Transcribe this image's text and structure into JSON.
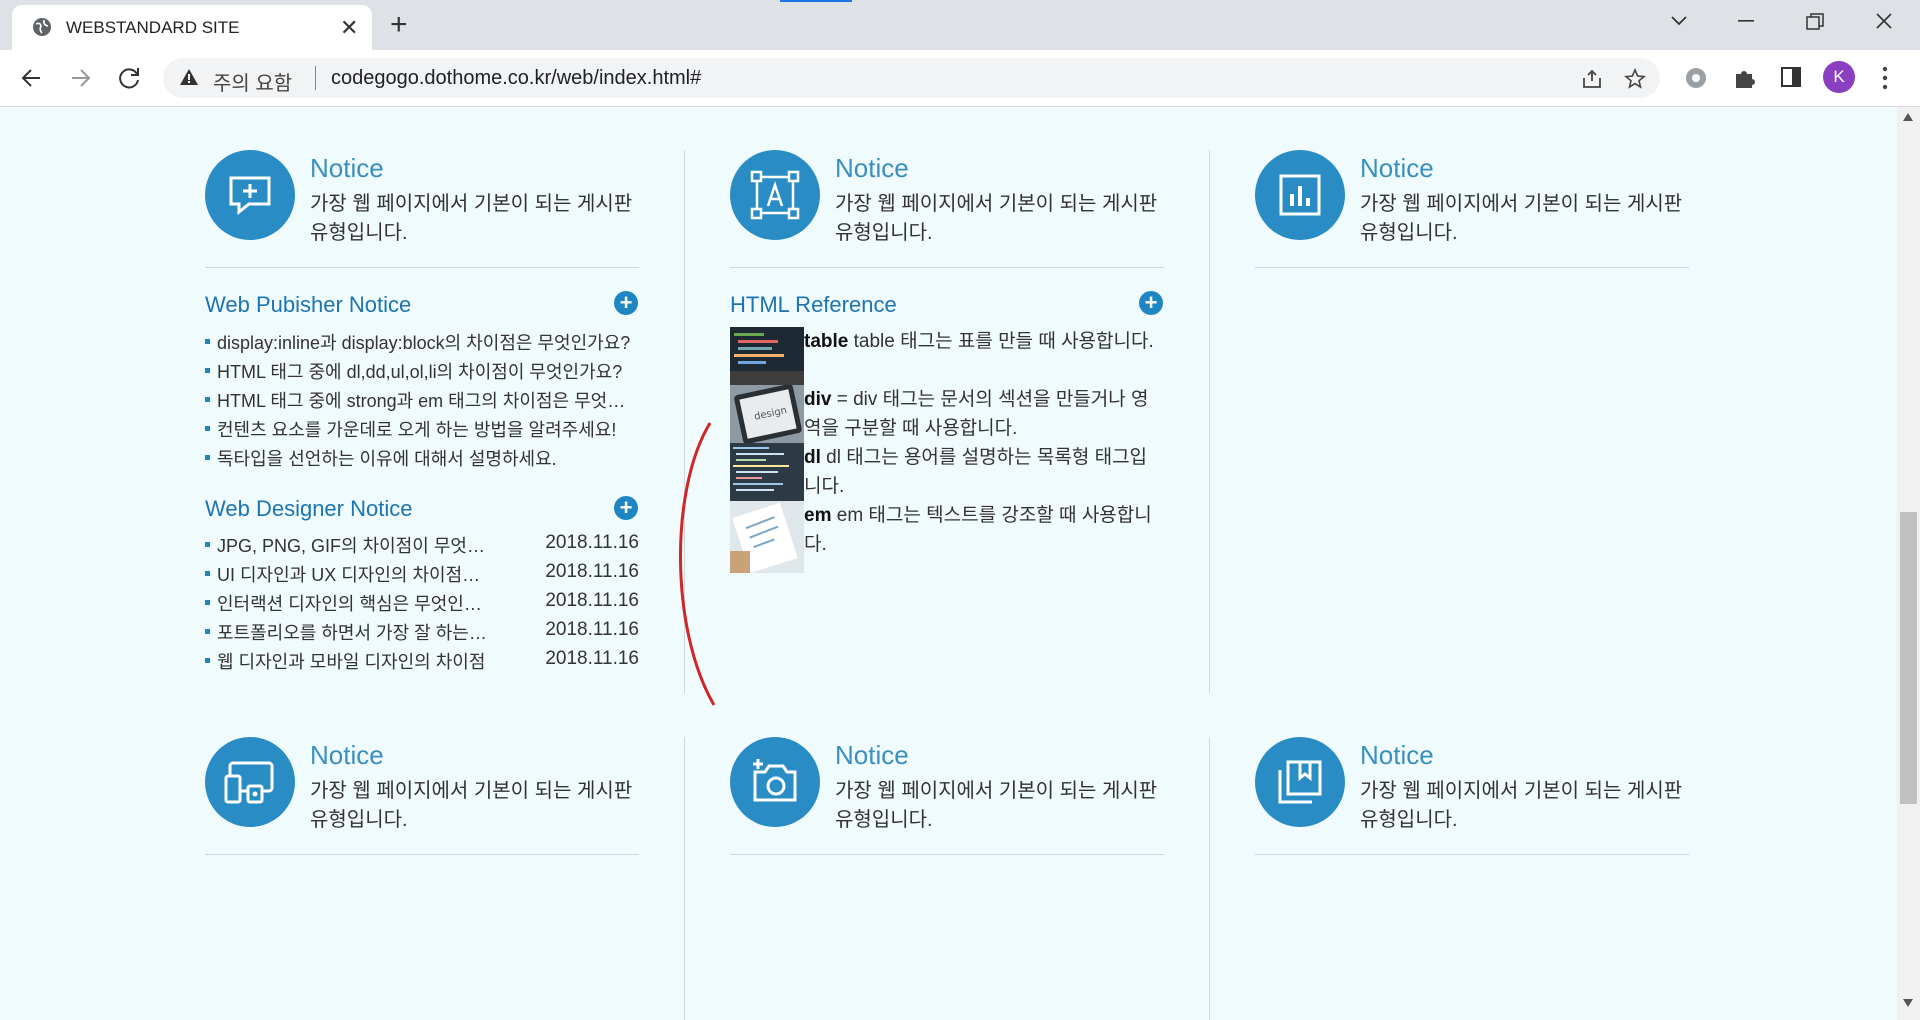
{
  "browser": {
    "tab_title": "WEBSTANDARD SITE",
    "close_glyph": "✕",
    "newtab_glyph": "+",
    "security_label": "주의 요함",
    "url": "codegogo.dothome.co.kr/web/index.html#",
    "avatar_letter": "K",
    "accent": "#2a8cc4"
  },
  "cards_top": [
    {
      "title": "Notice",
      "desc": "가장 웹 페이지에서 기본이 되는 게시판 유형입니다.",
      "icon": "chat-plus-icon"
    },
    {
      "title": "Notice",
      "desc": "가장 웹 페이지에서 기본이 되는 게시판 유형입니다.",
      "icon": "text-frame-icon"
    },
    {
      "title": "Notice",
      "desc": "가장 웹 페이지에서 기본이 되는 게시판 유형입니다.",
      "icon": "bar-chart-icon"
    }
  ],
  "cards_bottom": [
    {
      "title": "Notice",
      "desc": "가장 웹 페이지에서 기본이 되는 게시판 유형입니다.",
      "icon": "devices-icon"
    },
    {
      "title": "Notice",
      "desc": "가장 웹 페이지에서 기본이 되는 게시판 유형입니다.",
      "icon": "camera-plus-icon"
    },
    {
      "title": "Notice",
      "desc": "가장 웹 페이지에서 기본이 되는 게시판 유형입니다.",
      "icon": "bookmark-stack-icon"
    }
  ],
  "publisher": {
    "title": "Web Pubisher Notice",
    "more": "+",
    "items": [
      "display:inline과 display:block의 차이점은 무엇인가요?",
      "HTML 태그 중에 dl,dd,ul,ol,li의 차이점이 무엇인가요?",
      "HTML 태그 중에 strong과 em 태그의 차이점은 무엇인가요?",
      "컨텐츠 요소를 가운데로 오게 하는 방법을 알려주세요!",
      "독타입을 선언하는 이유에 대해서 설명하세요."
    ]
  },
  "designer": {
    "title": "Web Designer Notice",
    "more": "+",
    "items": [
      {
        "text": "JPG, PNG, GIF의 차이점이 무엇인가요?",
        "date": "2018.11.16"
      },
      {
        "text": "UI 디자인과 UX 디자인의 차이점은?",
        "date": "2018.11.16"
      },
      {
        "text": "인터랙션 디자인의 핵심은 무엇인가요?",
        "date": "2018.11.16"
      },
      {
        "text": "포트폴리오를 하면서 가장 잘 하는 방법",
        "date": "2018.11.16"
      },
      {
        "text": "웹 디자인과 모바일 디자인의 차이점",
        "date": "2018.11.16"
      }
    ]
  },
  "reference": {
    "title": "HTML Reference",
    "more": "+",
    "items": [
      {
        "tag": "table",
        "desc": " table 태그는 표를 만들 때 사용합니다."
      },
      {
        "tag": "div",
        "desc": " = div 태그는 문서의 섹션을 만들거나 영역을 구분할 때 사용합니다."
      },
      {
        "tag": "dl",
        "desc": " dl 태그는 용어를 설명하는 목록형 태그입니다."
      },
      {
        "tag": "em",
        "desc": " em 태그는 텍스트를 강조할 때 사용합니다."
      }
    ]
  }
}
